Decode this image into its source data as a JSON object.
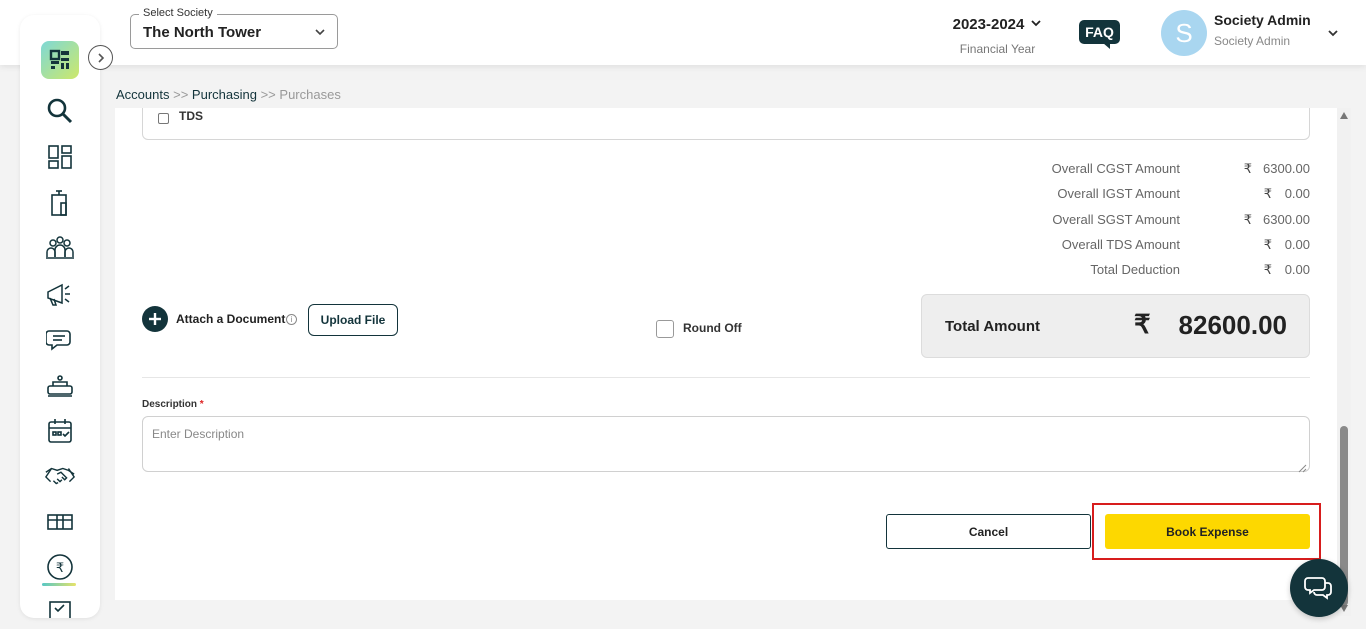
{
  "header": {
    "society_select_legend": "Select Society",
    "society_select_value": "The North Tower",
    "financial_year": "2023-2024",
    "financial_year_label": "Financial Year",
    "faq_label": "FAQ",
    "avatar_initial": "S",
    "user_name": "Society Admin",
    "user_role": "Society Admin"
  },
  "sidebar": {
    "items": [
      {
        "icon": "logo-icon"
      },
      {
        "icon": "search-icon"
      },
      {
        "icon": "dashboard-icon"
      },
      {
        "icon": "building-icon"
      },
      {
        "icon": "members-icon"
      },
      {
        "icon": "announcement-icon"
      },
      {
        "icon": "chat-icon"
      },
      {
        "icon": "facility-icon"
      },
      {
        "icon": "calendar-icon"
      },
      {
        "icon": "handshake-icon"
      },
      {
        "icon": "inventory-icon"
      },
      {
        "icon": "rupee-icon",
        "active": true
      },
      {
        "icon": "checklist-icon"
      }
    ]
  },
  "breadcrumb": {
    "accounts": "Accounts",
    "sep1": ">>",
    "purchasing": "Purchasing",
    "sep2": ">>",
    "purchases": "Purchases"
  },
  "form": {
    "tds_label": "TDS",
    "summary": [
      {
        "label": "Overall CGST Amount",
        "currency": "₹",
        "value": "6300.00"
      },
      {
        "label": "Overall IGST Amount",
        "currency": "₹",
        "value": "0.00"
      },
      {
        "label": "Overall SGST Amount",
        "currency": "₹",
        "value": "6300.00"
      },
      {
        "label": "Overall TDS Amount",
        "currency": "₹",
        "value": "0.00"
      },
      {
        "label": "Total Deduction",
        "currency": "₹",
        "value": "0.00"
      }
    ],
    "attach_label": "Attach a Document",
    "upload_label": "Upload File",
    "round_off_label": "Round Off",
    "total_label": "Total Amount",
    "total_currency": "₹",
    "total_value": "82600.00",
    "description_label": "Description",
    "description_required": "*",
    "description_placeholder": "Enter Description",
    "cancel_label": "Cancel",
    "book_label": "Book Expense"
  },
  "colors": {
    "primary": "#13343b",
    "accent": "#fdd800",
    "highlight": "#d71d1d"
  }
}
